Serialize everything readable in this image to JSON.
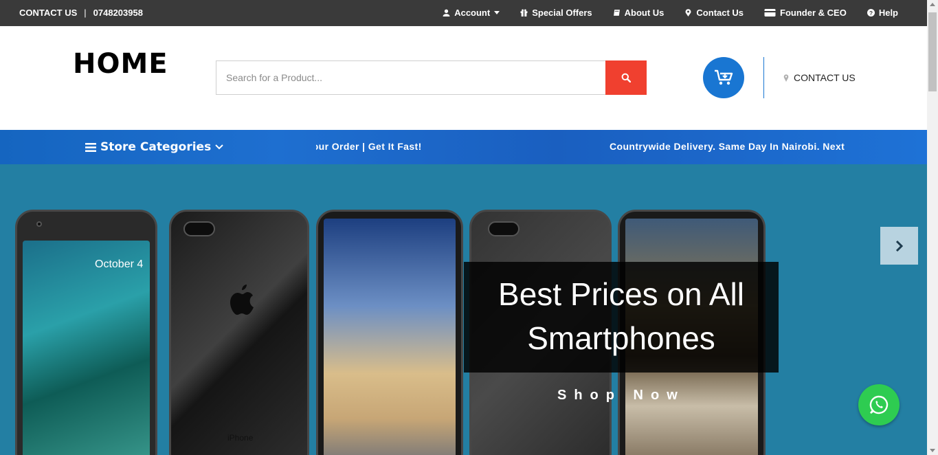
{
  "topbar": {
    "contact_label": "CONTACT US",
    "separator": "|",
    "phone": "0748203958",
    "nav": [
      {
        "label": "Account",
        "icon": "user-icon"
      },
      {
        "label": "Special Offers",
        "icon": "gift-icon"
      },
      {
        "label": "About Us",
        "icon": "book-icon"
      },
      {
        "label": "Contact Us",
        "icon": "map-marker-icon"
      },
      {
        "label": "Founder & CEO",
        "icon": "credit-card-icon"
      },
      {
        "label": "Help",
        "icon": "question-circle-icon"
      }
    ]
  },
  "header": {
    "logo": "HOME",
    "search_placeholder": "Search for a Product...",
    "contact_label": "CONTACT US"
  },
  "strip": {
    "categories_label": "Store Categories",
    "marquee_1": "Your Order | Get It Fast!",
    "marquee_2": "Countrywide Delivery. Same Day In Nairobi. Next"
  },
  "hero": {
    "phone_date": "October 4",
    "phone_brand": "iPhone",
    "caption": "Best Prices on All Smartphones",
    "cta": "Shop Now"
  },
  "colors": {
    "topbar": "#3a3a3a",
    "accent_red": "#f0402f",
    "accent_blue": "#1976d2",
    "hero_bg": "#237fa3",
    "whatsapp": "#2ecc51"
  }
}
